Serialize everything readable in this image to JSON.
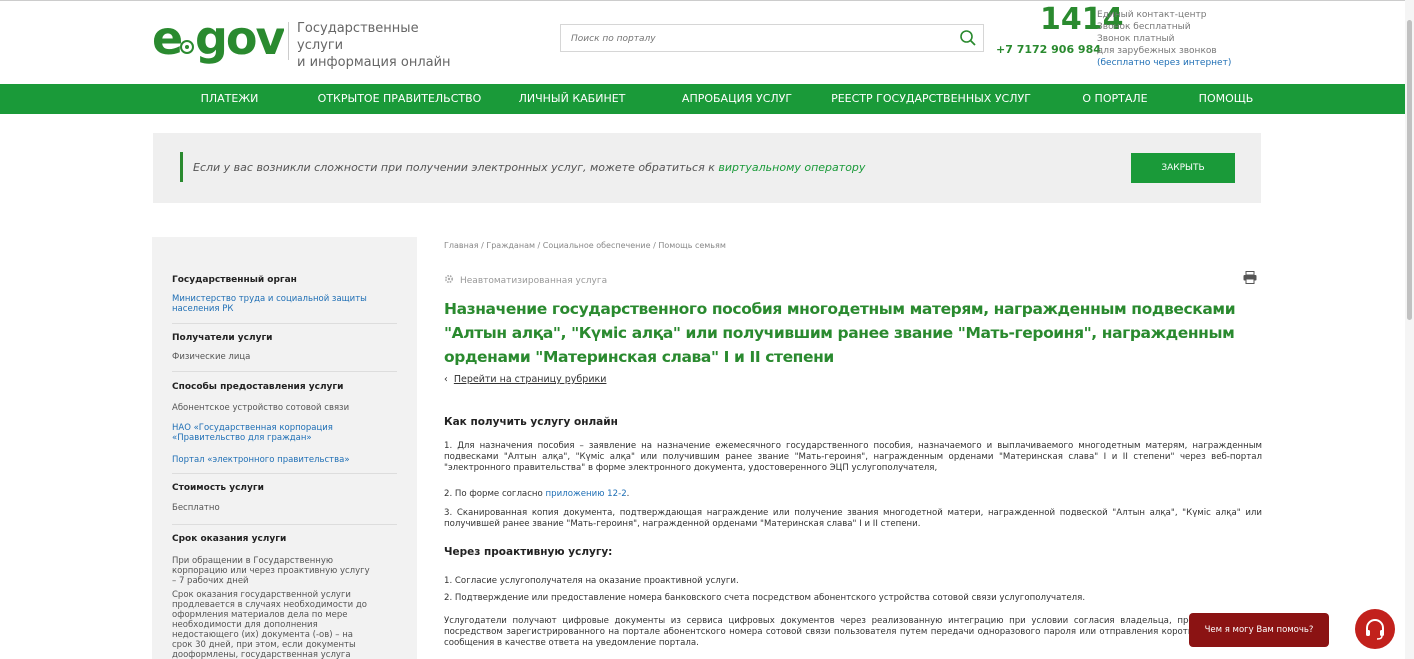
{
  "header": {
    "logo": "egov",
    "logo_sub_line1": "Государственные услуги",
    "logo_sub_line2": "и информация онлайн",
    "search_placeholder": "Поиск по порталу",
    "contact_number": "1414",
    "contact_phone": "+7 7172 906 984",
    "contact_lines": [
      "Единый контакт-центр",
      "Звонок бесплатный",
      "Звонок платный",
      "для зарубежных звонков"
    ],
    "contact_free_net": "(бесплатно через интернет)"
  },
  "nav": {
    "items": [
      "ПЛАТЕЖИ",
      "ОТКРЫТОЕ ПРАВИТЕЛЬСТВО",
      "ЛИЧНЫЙ КАБИНЕТ",
      "АПРОБАЦИЯ УСЛУГ",
      "РЕЕСТР ГОСУДАРСТВЕННЫХ УСЛУГ",
      "О ПОРТАЛЕ",
      "ПОМОЩЬ"
    ]
  },
  "notice": {
    "text": "Если у вас возникли сложности при получении электронных услуг, можете обратиться к ",
    "link": "виртуальному оператору",
    "close_label": "ЗАКРЫТЬ"
  },
  "sidebar": {
    "gov_body_title": "Государственный орган",
    "gov_body": "Министерство труда и социальной защиты населения РК",
    "recipients_title": "Получатели услуги",
    "recipients": "Физические лица",
    "methods_title": "Способы предоставления услуги",
    "method1": "Абонентское устройство сотовой связи",
    "method2": "НАО «Государственная корпорация «Правительство для граждан»",
    "method3": "Портал «электронного правительства»",
    "cost_title": "Стоимость услуги",
    "cost": "Бесплатно",
    "term_title": "Срок оказания услуги",
    "term1": "При обращении в Государственную корпорацию или через проактивную услугу – 7 рабочих дней",
    "term2": "Срок оказания государственной услуги продлевается в случаях необходимости до оформления материалов дела по мере необходимости для дополнения недостающего (их) документа (-ов) – на срок 30 дней, при этом, если документы дооформлены, государственная услуга оказывается в течение"
  },
  "main": {
    "breadcrumb": "Главная / Гражданам / Социальное обеспечение / Помощь семьям",
    "service_type": "Неавтоматизированная услуга",
    "title": "Назначение государственного пособия многодетным матерям, награжденным подвесками \"Алтын алқа\", \"Күміс алқа\" или получившим ранее звание \"Мать-героиня\", награжденным орденами \"Материнская слава\" I и II степени",
    "back_link": "Перейти на страницу рубрики",
    "online_title": "Как получить услугу онлайн",
    "online_1": "1. Для назначения пособия – заявление на назначение ежемесячного государственного пособия, назначаемого и выплачиваемого многодетным матерям, награжденным подвесками \"Алтын алқа\", \"Күміс алқа\" или получившим ранее звание \"Мать-героиня\", награжденным орденами \"Материнская слава\" I и II степени\" через веб-портал \"электронного правительства\" в форме электронного документа, удостоверенного ЭЦП услугополучателя,",
    "online_2_pre": "2. По форме согласно ",
    "online_2_link": "приложению 12-2",
    "online_2_post": ".",
    "online_3": "3. Сканированная копия документа, подтверждающая награждение или получение звания многодетной матери, награжденной подвеской \"Алтын алқа\", \"Күміс алқа\" или получившей ранее звание \"Мать-героиня\", награжденной орденами \"Материнская слава\" I и II степени.",
    "proactive_title": "Через проактивную услугу:",
    "proactive_1": "1. Согласие услугополучателя на оказание проактивной услуги.",
    "proactive_2": "2. Подтверждение или предоставление номера банковского счета посредством абонентского устройства сотовой связи услугополучателя.",
    "proactive_text": "Услугодатели получают цифровые документы из сервиса цифровых документов через реализованную интеграцию при условии согласия владельца, предоставленного посредством зарегистрированного на портале абонентского номера сотовой связи пользователя путем передачи одноразового пароля или отправления короткого текстового сообщения в качестве ответа на уведомление портала."
  },
  "help": {
    "bubble": "Чем я могу Вам помочь?"
  },
  "colors": {
    "brand_green": "#1a9a39",
    "title_green": "#2a8a2f",
    "help_red": "#c2211c"
  }
}
